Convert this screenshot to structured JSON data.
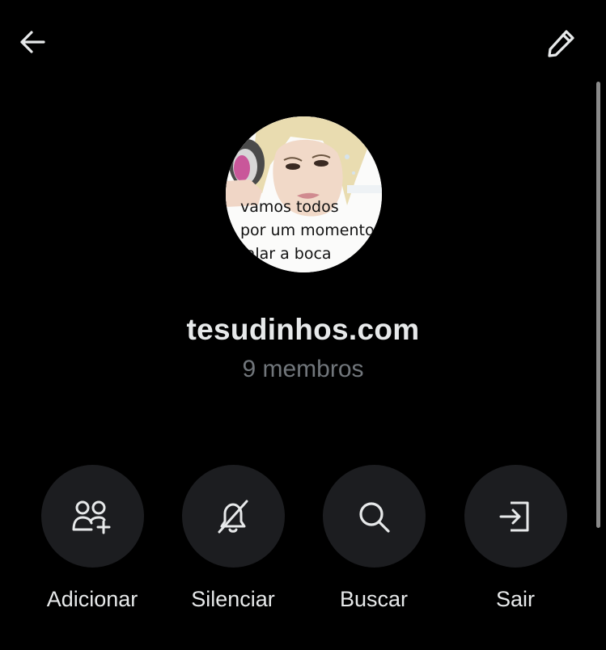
{
  "header": {
    "back_icon": "arrow-left-icon",
    "edit_icon": "pencil-icon"
  },
  "group": {
    "avatar_caption": "vamos todos\npor um momento\nfalar a boca",
    "name": "tesudinhos.com",
    "members": "9 membros"
  },
  "actions": [
    {
      "label": "Adicionar",
      "icon": "add-people-icon"
    },
    {
      "label": "Silenciar",
      "icon": "bell-off-icon"
    },
    {
      "label": "Buscar",
      "icon": "search-icon"
    },
    {
      "label": "Sair",
      "icon": "exit-icon"
    }
  ],
  "colors": {
    "background": "#000000",
    "primary_text": "#e7e9ea",
    "secondary_text": "#71767b",
    "button_bg": "#1c1d20"
  }
}
